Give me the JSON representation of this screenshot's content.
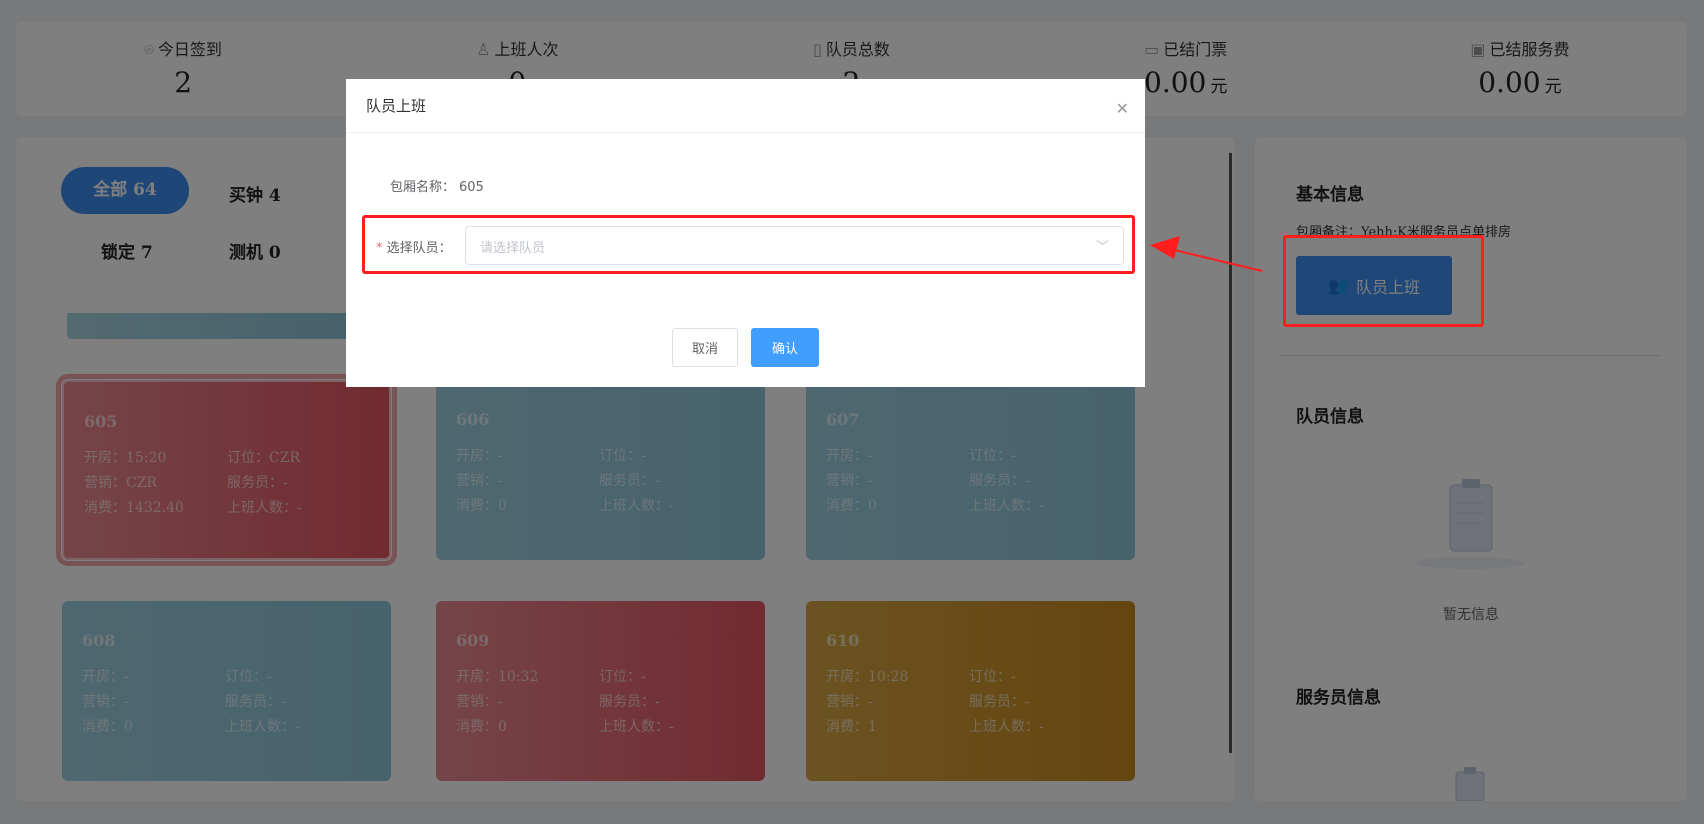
{
  "stats": [
    {
      "icon": "location-icon",
      "label": "今日签到",
      "value": "2",
      "unit": ""
    },
    {
      "icon": "person-icon",
      "label": "上班人次",
      "value": "0",
      "unit": ""
    },
    {
      "icon": "contact-book-icon",
      "label": "队员总数",
      "value": "2",
      "unit": ""
    },
    {
      "icon": "ticket-icon",
      "label": "已结门票",
      "value": "0.00",
      "unit": "元"
    },
    {
      "icon": "gift-icon",
      "label": "已结服务费",
      "value": "0.00",
      "unit": "元"
    }
  ],
  "tabs": [
    "全部 64",
    "买钟 4",
    "锁定 7",
    "测机 0"
  ],
  "rooms": [
    {
      "no": "605",
      "open": "开房：15:20",
      "book": "订位：CZR",
      "sales": "营销：CZR",
      "waiter": "服务员：-",
      "spend": "消费：1432.40",
      "staff": "上班人数：-"
    },
    {
      "no": "606",
      "open": "开房：-",
      "book": "订位：-",
      "sales": "营销：-",
      "waiter": "服务员：-",
      "spend": "消费：0",
      "staff": "上班人数：-"
    },
    {
      "no": "607",
      "open": "开房：-",
      "book": "订位：-",
      "sales": "营销：-",
      "waiter": "服务员：-",
      "spend": "消费：0",
      "staff": "上班人数：-"
    },
    {
      "no": "608",
      "open": "开房：-",
      "book": "订位：-",
      "sales": "营销：-",
      "waiter": "服务员：-",
      "spend": "消费：0",
      "staff": "上班人数：-"
    },
    {
      "no": "609",
      "open": "开房：10:32",
      "book": "订位：-",
      "sales": "营销：-",
      "waiter": "服务员：-",
      "spend": "消费：0",
      "staff": "上班人数：-"
    },
    {
      "no": "610",
      "open": "开房：10:28",
      "book": "订位：-",
      "sales": "营销：-",
      "waiter": "服务员：-",
      "spend": "消费：1",
      "staff": "上班人数：-"
    }
  ],
  "right": {
    "basic_title": "基本信息",
    "note": "包厢备注：Yehh;K米服务员点单排房",
    "join_btn": "队员上班",
    "member_title": "队员信息",
    "empty": "暂无信息",
    "waiter_title": "服务员信息"
  },
  "modal": {
    "title": "队员上班",
    "room_label": "包厢名称：",
    "room_value": "605",
    "select_label": "选择队员：",
    "select_placeholder": "请选择队员",
    "cancel": "取消",
    "confirm": "确认"
  },
  "colors": {
    "primary": "#409eff",
    "highlight": "#ff1e1e",
    "card_blue": "#8ec6da",
    "card_red": "#e25560",
    "card_gold": "#c98b1e"
  }
}
